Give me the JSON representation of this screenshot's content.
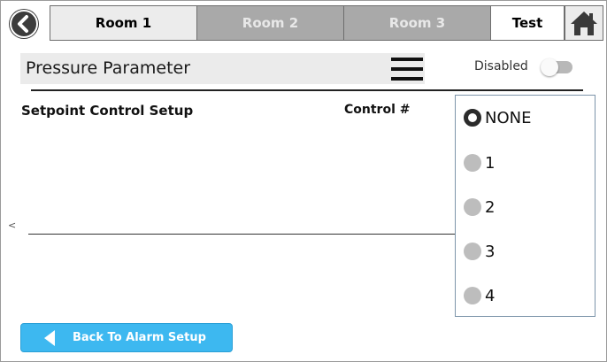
{
  "nav": {
    "tabs": [
      {
        "label": "Room 1",
        "state": "active"
      },
      {
        "label": "Room 2",
        "state": "inactive"
      },
      {
        "label": "Room 3",
        "state": "inactive"
      },
      {
        "label": "Test",
        "state": "selected"
      }
    ],
    "back_icon": "chevron-left-icon",
    "home_icon": "home-icon"
  },
  "header": {
    "title": "Pressure Parameter",
    "menu_icon": "hamburger-menu-icon",
    "toggle_label": "Disabled",
    "toggle_on": false
  },
  "section": {
    "title": "Setpoint Control Setup",
    "control_label": "Control #",
    "edge_mark": "<"
  },
  "dropdown": {
    "selected": "NONE",
    "options": [
      "NONE",
      "1",
      "2",
      "3",
      "4"
    ]
  },
  "footer": {
    "back_label": "Back To Alarm Setup"
  },
  "colors": {
    "accent": "#3db8f0",
    "tab_active": "#ececec",
    "tab_inactive": "#a9a9a9"
  }
}
